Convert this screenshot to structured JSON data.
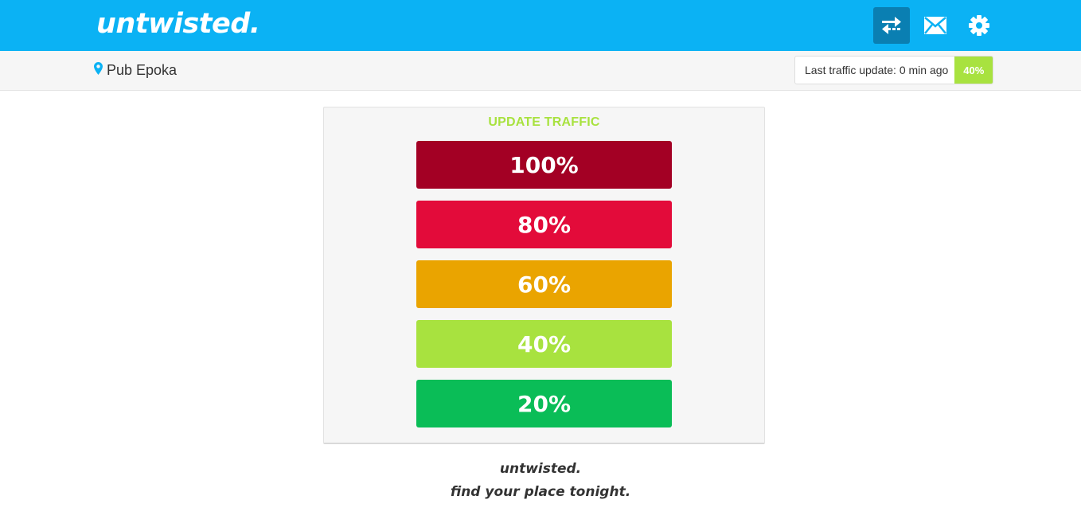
{
  "header": {
    "brand": "untwisted.",
    "icons": [
      {
        "name": "swap-icon",
        "active": true
      },
      {
        "name": "mail-icon",
        "active": false
      },
      {
        "name": "gear-icon",
        "active": false
      }
    ]
  },
  "subbar": {
    "location_icon": "map-pin-icon",
    "location": "Pub Epoka",
    "last_update_label": "Last traffic update: 0 min ago",
    "current_traffic": "40%"
  },
  "panel": {
    "title": "UPDATE TRAFFIC",
    "levels": [
      {
        "label": "100%",
        "color": "#a30024"
      },
      {
        "label": "80%",
        "color": "#e30b3a"
      },
      {
        "label": "60%",
        "color": "#eaa400"
      },
      {
        "label": "40%",
        "color": "#a8e23f"
      },
      {
        "label": "20%",
        "color": "#0abd57"
      }
    ]
  },
  "footer": {
    "brand": "untwisted.",
    "tagline": "find your place tonight."
  },
  "colors": {
    "topbar": "#0bb2f4",
    "active_nav": "#0a7fb2",
    "accent_green": "#a8e23f"
  }
}
